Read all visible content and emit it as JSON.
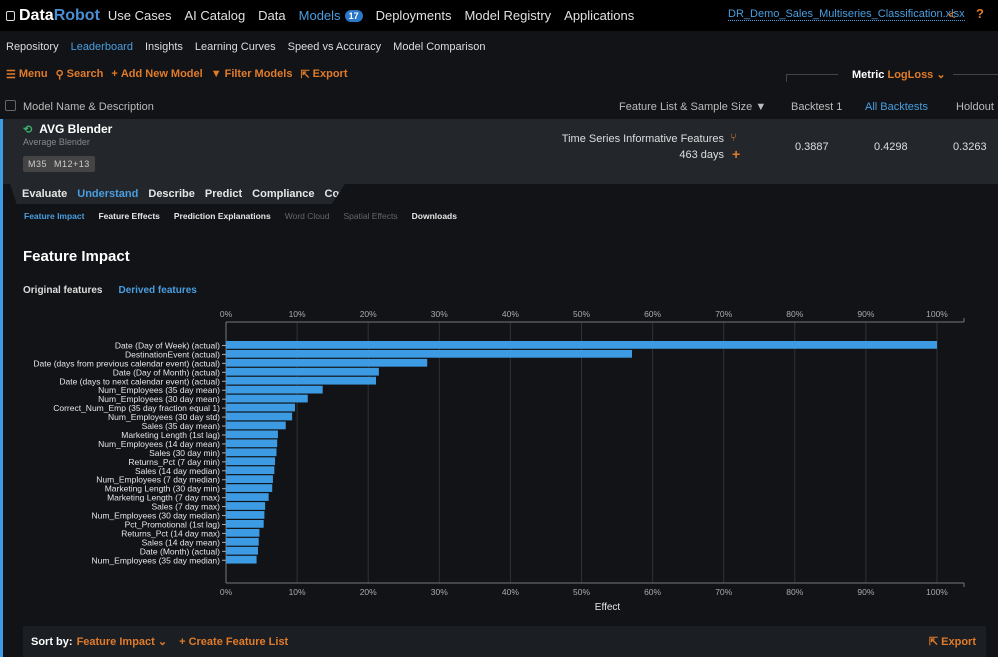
{
  "app": {
    "brand_a": "Data",
    "brand_b": "Robot",
    "project_file": "DR_Demo_Sales_Multiseries_Classification.xlsx"
  },
  "topnav": [
    {
      "label": "Use Cases"
    },
    {
      "label": "AI Catalog"
    },
    {
      "label": "Data"
    },
    {
      "label": "Models",
      "badge": "17",
      "active": true
    },
    {
      "label": "Deployments"
    },
    {
      "label": "Model Registry"
    },
    {
      "label": "Applications"
    }
  ],
  "subnav": [
    {
      "label": "Repository"
    },
    {
      "label": "Leaderboard",
      "active": true
    },
    {
      "label": "Insights"
    },
    {
      "label": "Learning Curves"
    },
    {
      "label": "Speed vs Accuracy"
    },
    {
      "label": "Model Comparison"
    }
  ],
  "toolbar": {
    "menu": "Menu",
    "search": "Search",
    "add_model": "Add New Model",
    "filter": "Filter Models",
    "export": "Export"
  },
  "metric": {
    "label": "Metric",
    "value": "LogLoss"
  },
  "table_header": {
    "name": "Model Name & Description",
    "featurelist": "Feature List & Sample Size",
    "backtest1": "Backtest 1",
    "all_backtests": "All Backtests",
    "holdout": "Holdout"
  },
  "model": {
    "name": "AVG Blender",
    "description": "Average Blender",
    "tags": [
      "M35",
      "M12+13"
    ],
    "feature_list": "Time Series Informative Features",
    "sample_size": "463 days",
    "backtest1": "0.3887",
    "all_backtests": "0.4298",
    "holdout": "0.3263"
  },
  "tabs": [
    {
      "label": "Evaluate"
    },
    {
      "label": "Understand",
      "active": true
    },
    {
      "label": "Describe"
    },
    {
      "label": "Predict"
    },
    {
      "label": "Compliance"
    },
    {
      "label": "Comments"
    }
  ],
  "subtabs": [
    {
      "label": "Feature Impact",
      "state": "active"
    },
    {
      "label": "Feature Effects",
      "state": "normal"
    },
    {
      "label": "Prediction Explanations",
      "state": "normal"
    },
    {
      "label": "Word Cloud",
      "state": "disabled"
    },
    {
      "label": "Spatial Effects",
      "state": "disabled"
    },
    {
      "label": "Downloads",
      "state": "normal"
    }
  ],
  "section_title": "Feature Impact",
  "feature_toggle": {
    "original": "Original features",
    "derived": "Derived features"
  },
  "chart_data": {
    "type": "bar",
    "orientation": "horizontal",
    "xlabel": "Effect",
    "xlim": [
      0,
      100
    ],
    "x_ticks": [
      "0%",
      "10%",
      "20%",
      "30%",
      "40%",
      "50%",
      "60%",
      "70%",
      "80%",
      "90%",
      "100%"
    ],
    "grid": true,
    "bar_color": "#3d9be3",
    "categories": [
      "Date (Day of Week) (actual)",
      "DestinationEvent (actual)",
      "Date (days from previous calendar event) (actual)",
      "Date (Day of Month) (actual)",
      "Date (days to next calendar event) (actual)",
      "Num_Employees (35 day mean)",
      "Num_Employees (30 day mean)",
      "Correct_Num_Emp (35 day fraction equal 1)",
      "Num_Employees (30 day std)",
      "Sales (35 day mean)",
      "Marketing Length (1st lag)",
      "Num_Employees (14 day mean)",
      "Sales (30 day min)",
      "Returns_Pct (7 day min)",
      "Sales (14 day median)",
      "Num_Employees (7 day median)",
      "Marketing Length (30 day min)",
      "Marketing Length (7 day max)",
      "Sales (7 day max)",
      "Num_Employees (30 day median)",
      "Pct_Promotional (1st lag)",
      "Returns_Pct (14 day max)",
      "Sales (14 day mean)",
      "Date (Month) (actual)",
      "Num_Employees (35 day median)"
    ],
    "values": [
      100,
      57.1,
      28.3,
      21.5,
      21.1,
      13.6,
      11.5,
      9.7,
      9.3,
      8.4,
      7.3,
      7.2,
      7.1,
      6.9,
      6.8,
      6.6,
      6.5,
      6.0,
      5.5,
      5.4,
      5.3,
      4.7,
      4.6,
      4.5,
      4.3
    ]
  },
  "footer": {
    "sort_label": "Sort by:",
    "sort_value": "Feature Impact",
    "create_list": "Create Feature List",
    "export": "Export"
  }
}
